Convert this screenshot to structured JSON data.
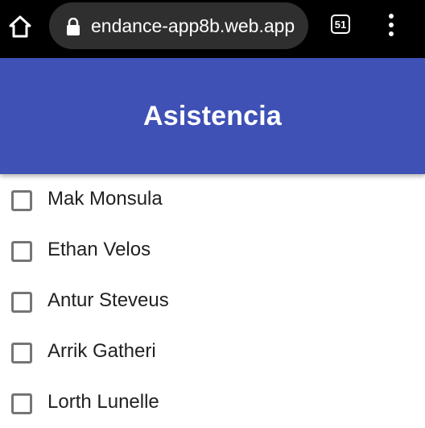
{
  "browser": {
    "url": "endance-app8b.web.app",
    "tab_count": "51",
    "home_icon": "home-icon",
    "lock_icon": "lock-icon",
    "menu_icon": "more-vert-icon"
  },
  "header": {
    "title": "Asistencia",
    "color": "#3f51b5"
  },
  "students": [
    {
      "name": "Mak Monsula",
      "checked": false
    },
    {
      "name": "Ethan Velos",
      "checked": false
    },
    {
      "name": "Antur Steveus",
      "checked": false
    },
    {
      "name": "Arrik Gatheri",
      "checked": false
    },
    {
      "name": "Lorth Lunelle",
      "checked": false
    }
  ]
}
